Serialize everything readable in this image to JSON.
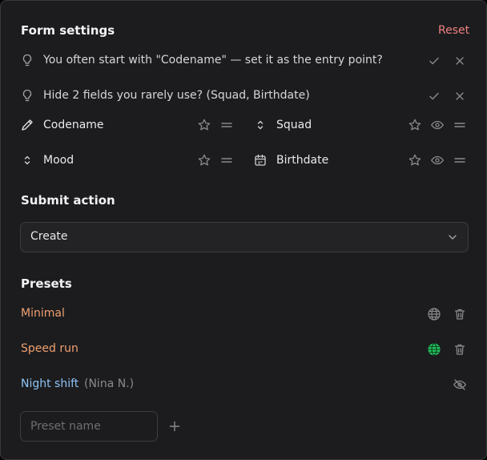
{
  "form_settings": {
    "title": "Form settings",
    "reset_label": "Reset"
  },
  "suggestions": [
    {
      "text": "You often start with \"Codename\" — set it as the entry point?"
    },
    {
      "text": "Hide 2 fields you rarely use? (Squad, Birthdate)"
    }
  ],
  "fields": [
    {
      "label": "Codename",
      "icon": "pencil-icon"
    },
    {
      "label": "Squad",
      "icon": "sort-arrows-icon"
    },
    {
      "label": "Mood",
      "icon": "sort-arrows-icon"
    },
    {
      "label": "Birthdate",
      "icon": "calendar-icon"
    }
  ],
  "submit_action": {
    "title": "Submit action",
    "selected": "Create"
  },
  "presets": {
    "title": "Presets",
    "items": [
      {
        "name": "Minimal",
        "owner": "",
        "color": "#f0a070"
      },
      {
        "name": "Speed run",
        "owner": "",
        "color": "#f0a070",
        "globe_color": "#22c55e"
      },
      {
        "name": "Night shift",
        "owner": "(Nina N.)",
        "color": "#8ec3f5"
      }
    ],
    "input_placeholder": "Preset name"
  },
  "colors": {
    "accent_reset": "#f08080",
    "globe_active": "#22c55e"
  }
}
